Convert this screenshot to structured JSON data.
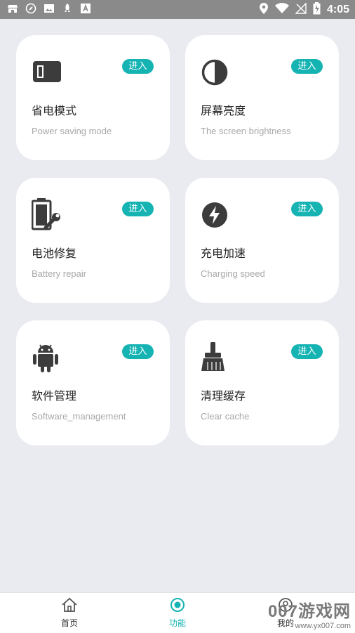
{
  "status_bar": {
    "time": "4:05"
  },
  "cards": [
    {
      "title": "省电模式",
      "subtitle": "Power saving mode",
      "enter": "进入",
      "icon": "power-saving-icon"
    },
    {
      "title": "屏幕亮度",
      "subtitle": "The screen brightness",
      "enter": "进入",
      "icon": "brightness-icon"
    },
    {
      "title": "电池修复",
      "subtitle": "Battery repair",
      "enter": "进入",
      "icon": "battery-repair-icon"
    },
    {
      "title": "充电加速",
      "subtitle": "Charging speed",
      "enter": "进入",
      "icon": "lightning-icon"
    },
    {
      "title": "软件管理",
      "subtitle": "Software_management",
      "enter": "进入",
      "icon": "android-icon"
    },
    {
      "title": "清理缓存",
      "subtitle": "Clear cache",
      "enter": "进入",
      "icon": "broom-icon"
    }
  ],
  "nav": {
    "home_label": "首页",
    "function_label": "功能",
    "mine_label": "我的"
  },
  "watermark": {
    "main": "007游戏网",
    "url": "www.yx007.com"
  },
  "colors": {
    "accent": "#16b3b3",
    "background": "#e9ebf0",
    "status_bar": "#8a8a8a"
  }
}
